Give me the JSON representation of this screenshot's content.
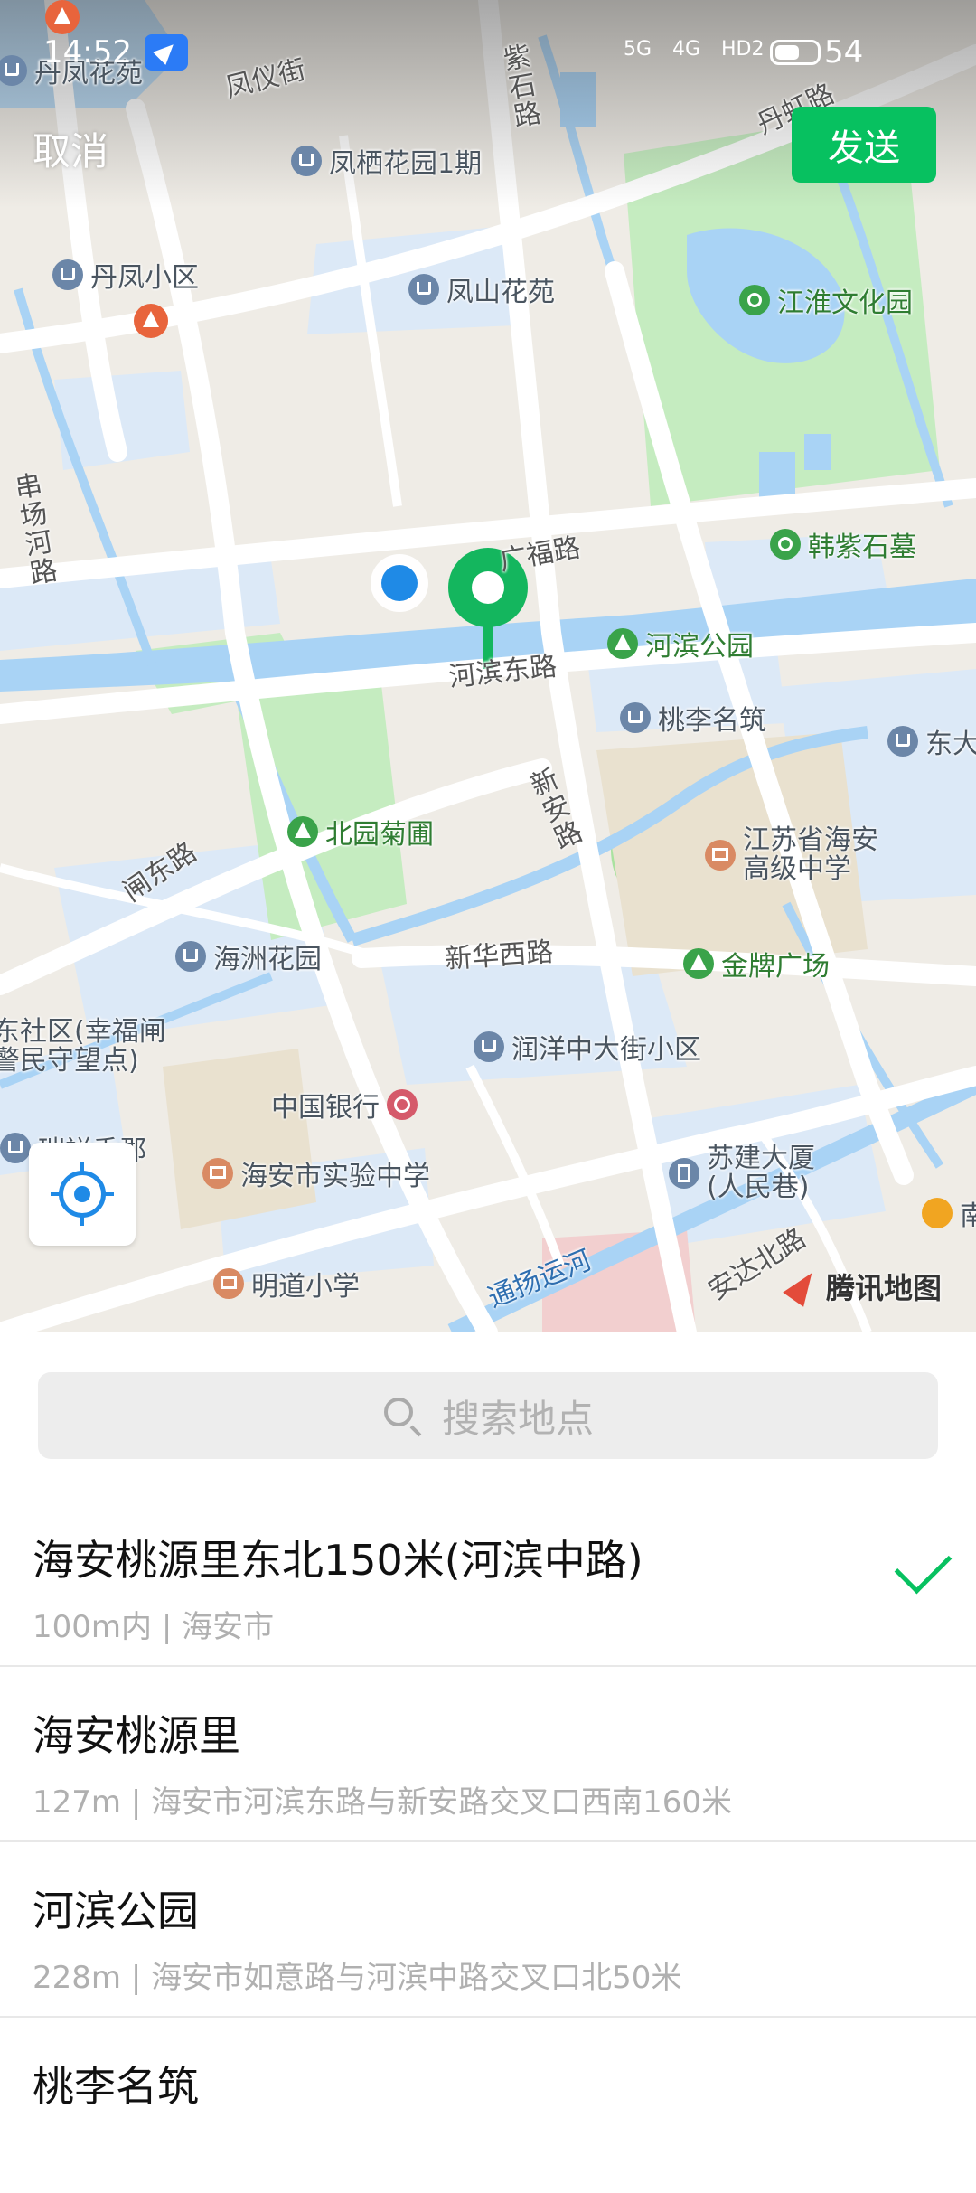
{
  "status_bar": {
    "time": "14:52",
    "signal1": "5G",
    "signal2": "4G",
    "hd": "HD2",
    "battery": "54"
  },
  "header": {
    "cancel": "取消",
    "send": "发送"
  },
  "map": {
    "pois": [
      {
        "name": "丹凤花苑",
        "icon": "house-icon"
      },
      {
        "name": "凤栖花园1期",
        "icon": "house-icon"
      },
      {
        "name": "丹凤小区",
        "icon": "house-icon"
      },
      {
        "name": "凤山花苑",
        "icon": "house-icon"
      },
      {
        "name": "江淮文化园",
        "icon": "camera-icon"
      },
      {
        "name": "韩紫石墓",
        "icon": "camera-icon"
      },
      {
        "name": "河滨公园",
        "icon": "tree-icon"
      },
      {
        "name": "桃李名筑",
        "icon": "house-icon"
      },
      {
        "name": "东大",
        "icon": "house-icon"
      },
      {
        "name": "北园菊圃",
        "icon": "tree-icon"
      },
      {
        "name": "江苏省海安\n高级中学",
        "icon": "school-icon"
      },
      {
        "name": "海洲花园",
        "icon": "house-icon"
      },
      {
        "name": "金牌广场",
        "icon": "tree-icon"
      },
      {
        "name": "润洋中大街小区",
        "icon": "house-icon"
      },
      {
        "name": "东社区(幸福闸\n警民守望点)",
        "icon": "none"
      },
      {
        "name": "中国银行",
        "icon": "bank-icon"
      },
      {
        "name": "瑞祥香郡",
        "icon": "house-icon"
      },
      {
        "name": "海安市实验中学",
        "icon": "school-icon"
      },
      {
        "name": "苏建大厦\n(人民巷)",
        "icon": "office-icon"
      },
      {
        "name": "明道小学",
        "icon": "school-icon"
      },
      {
        "name": "南",
        "icon": "shop-icon"
      }
    ],
    "roads": [
      "凤仪街",
      "紫石路",
      "丹虹路",
      "串场河路",
      "广福路",
      "河滨东路",
      "新安路",
      "闸东路",
      "新华西路",
      "通扬运河",
      "安达北路"
    ],
    "logo": "腾讯地图"
  },
  "search": {
    "placeholder": "搜索地点"
  },
  "results": [
    {
      "title": "海安桃源里东北150米(河滨中路)",
      "subtitle": "100m内 | 海安市",
      "selected": true
    },
    {
      "title": "海安桃源里",
      "subtitle": "127m | 海安市河滨东路与新安路交叉口西南160米",
      "selected": false
    },
    {
      "title": "河滨公园",
      "subtitle": "228m | 海安市如意路与河滨中路交叉口北50米",
      "selected": false
    },
    {
      "title": "桃李名筑",
      "subtitle": "",
      "selected": false
    }
  ],
  "colors": {
    "accent": "#07c160",
    "water": "#a9d3f5",
    "park": "#c5ecc0",
    "residential": "#dce9f7",
    "pin": "#14b65e",
    "my_location": "#1f8ae6"
  }
}
